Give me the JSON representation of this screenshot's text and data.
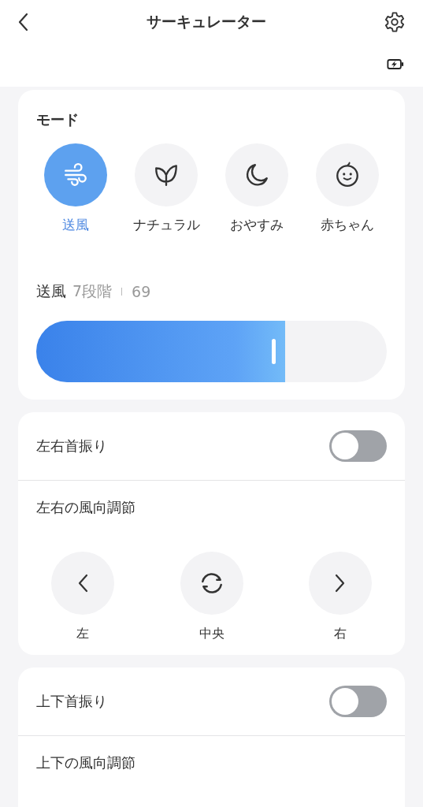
{
  "header": {
    "title": "サーキュレーター"
  },
  "mode_card": {
    "title": "モード",
    "modes": [
      {
        "kind": "wind",
        "label": "送風",
        "selected": true
      },
      {
        "kind": "leaf",
        "label": "ナチュラル",
        "selected": false
      },
      {
        "kind": "moon",
        "label": "おやすみ",
        "selected": false
      },
      {
        "kind": "baby",
        "label": "赤ちゃん",
        "selected": false
      }
    ],
    "speed": {
      "label": "送風",
      "steps": "7段階",
      "value": "69",
      "level": 0.71
    }
  },
  "horizontal_card": {
    "swing": {
      "label": "左右首振り",
      "on": false
    },
    "direction_title": "左右の風向調節",
    "directions": [
      {
        "kind": "left",
        "label": "左"
      },
      {
        "kind": "center",
        "label": "中央"
      },
      {
        "kind": "right",
        "label": "右"
      }
    ]
  },
  "vertical_card": {
    "swing": {
      "label": "上下首振り",
      "on": false
    },
    "direction_title": "上下の風向調節"
  }
}
